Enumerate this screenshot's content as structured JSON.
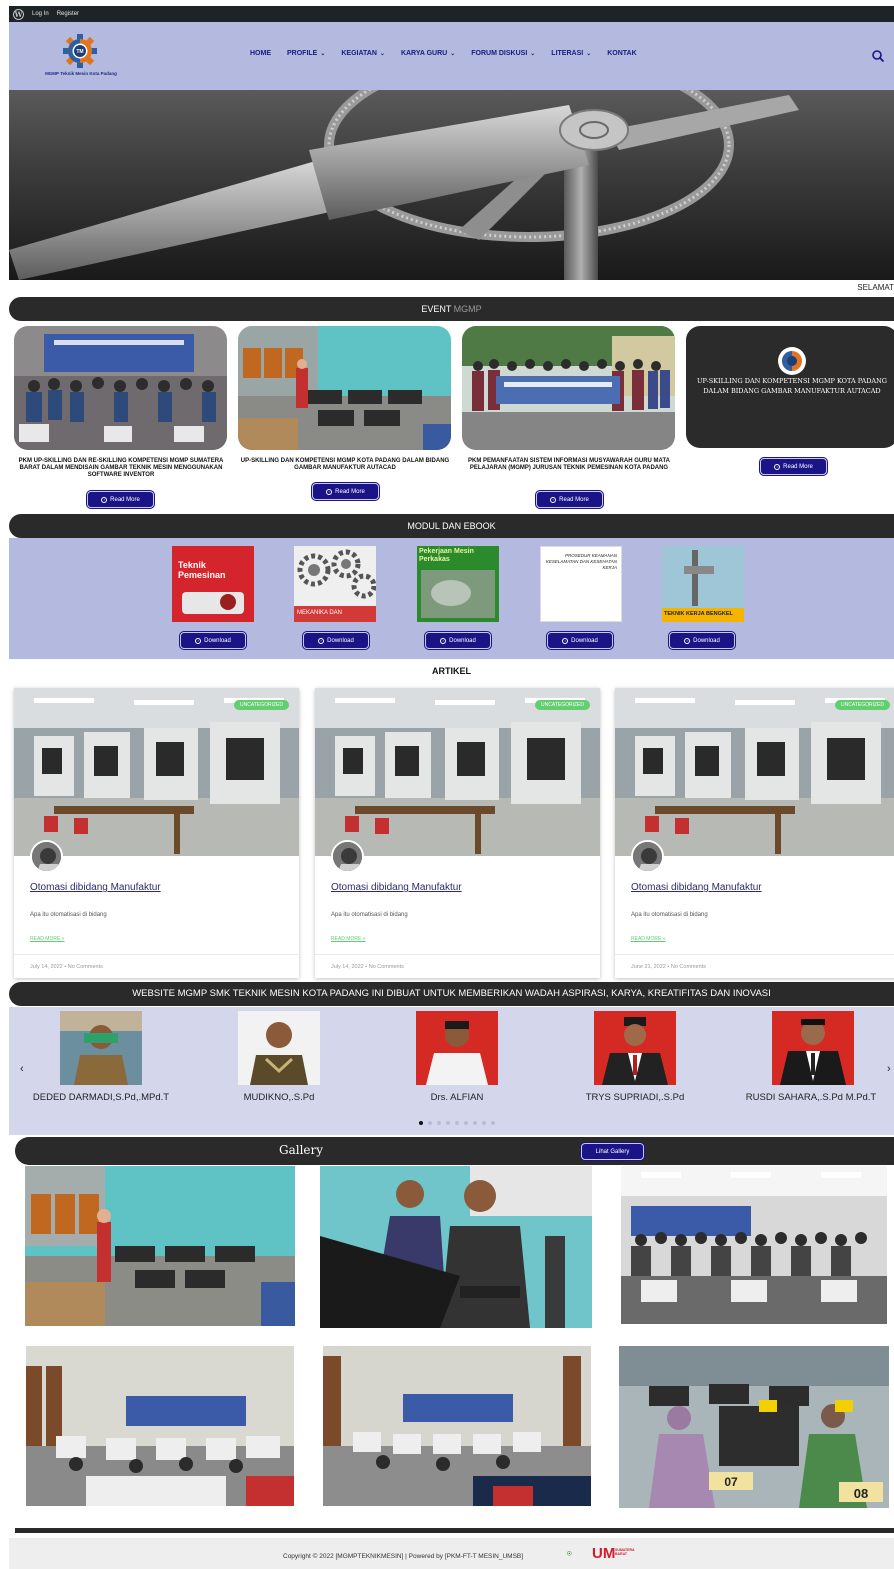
{
  "adminbar": {
    "login": "Log In",
    "register": "Register"
  },
  "header": {
    "logo_tagline": "MGMP Teknik Mesin Kota Padang",
    "logo_mark": "TM",
    "nav": [
      {
        "label": "HOME",
        "dropdown": false
      },
      {
        "label": "PROFILE",
        "dropdown": true
      },
      {
        "label": "KEGIATAN",
        "dropdown": true
      },
      {
        "label": "KARYA GURU",
        "dropdown": true
      },
      {
        "label": "FORUM DISKUSI",
        "dropdown": true
      },
      {
        "label": "LITERASI",
        "dropdown": true
      },
      {
        "label": "KONTAK",
        "dropdown": false
      }
    ],
    "search_icon": "search-icon"
  },
  "ticker": "SELAMAT",
  "events": {
    "heading_strong": "EVENT",
    "heading_light": " MGMP",
    "items": [
      {
        "title": "PKM UP-SKILLING DAN RE-SKILLING KOMPETENSI MGMP SUMATERA BARAT DALAM MENDISAIN GAMBAR TEKNIK MESIN MENGGUNAKAN SOFTWARE INVENTOR",
        "button": "Read More"
      },
      {
        "title": "UP-SKILLING DAN KOMPETENSI MGMP KOTA PADANG DALAM BIDANG GAMBAR MANUFAKTUR AUTACAD",
        "button": "Read More"
      },
      {
        "title": "PKM PEMANFAATAN SISTEM INFORMASI MUSYAWARAH GURU MATA PELAJARAN (MGMP) JURUSAN TEKNIK PEMESINAN KOTA PADANG",
        "button": "Read More"
      },
      {
        "title": "UP-SKILLING DAN KOMPETENSI MGMP KOTA PADANG DALAM BIDANG GAMBAR MANUFAKTUR AUTACAD",
        "button": "Read More"
      }
    ]
  },
  "modul": {
    "heading": "MODUL DAN EBOOK",
    "books": [
      {
        "cover": "Teknik Pemesinan",
        "button": "Download"
      },
      {
        "cover": "MEKANIKA DAN",
        "button": "Download"
      },
      {
        "cover": "Pekerjaan Mesin Perkakas",
        "button": "Download"
      },
      {
        "cover": "PROSEDUR KEAMANAN KESELAMATAN DAN KESEHATAN KERJA",
        "button": "Download"
      },
      {
        "cover": "TEKNIK KERJA BENGKEL",
        "button": "Download"
      }
    ]
  },
  "artikel": {
    "heading": "ARTIKEL",
    "cards": [
      {
        "badge": "UNCATEGORIZED",
        "title": "Otomasi dibidang Manufaktur",
        "excerpt": "Apa itu otomatisasi di bidang",
        "more": "READ MORE »",
        "date": "July 14, 2022",
        "comments": "No Comments"
      },
      {
        "badge": "UNCATEGORIZED",
        "title": "Otomasi dibidang Manufaktur",
        "excerpt": "Apa itu otomatisasi di bidang",
        "more": "READ MORE »",
        "date": "July 14, 2022",
        "comments": "No Comments"
      },
      {
        "badge": "UNCATEGORIZED",
        "title": "Otomasi dibidang Manufaktur",
        "excerpt": "Apa itu otomatisasi di bidang",
        "more": "READ MORE »",
        "date": "June 21, 2022",
        "comments": "No Comments"
      }
    ],
    "meta_sep": "•"
  },
  "tagline": "WEBSITE MGMP SMK TEKNIK MESIN KOTA PADANG INI DIBUAT UNTUK MEMBERIKAN WADAH ASPIRASI, KARYA, KREATIFITAS DAN INOVASI",
  "teachers": {
    "prev": "‹",
    "next": "›",
    "items": [
      {
        "name": "DEDED DARMADI,S.Pd,.MPd.T"
      },
      {
        "name": "MUDIKNO,.S.Pd"
      },
      {
        "name": "Drs. ALFIAN"
      },
      {
        "name": "TRYS SUPRIADI,.S.Pd"
      },
      {
        "name": "RUSDI SAHARA,.S.Pd M.Pd.T"
      }
    ],
    "dots_total": 9,
    "dots_active": 1
  },
  "gallery": {
    "heading": "Gallery",
    "button": "Lihat Gallery"
  },
  "footer": {
    "text": "Copyright © 2022 [MGMPTEKNIKMESIN] | Powered by [PKM-FT-T MESIN_UMSB]",
    "logo_text": "UM",
    "logo_sub": "SUMATERA BARAT"
  },
  "colors": {
    "nav_bg": "#b3b9df",
    "button": "#1b1487",
    "dark_bar": "#2a2a2a",
    "badge": "#61ce70"
  }
}
